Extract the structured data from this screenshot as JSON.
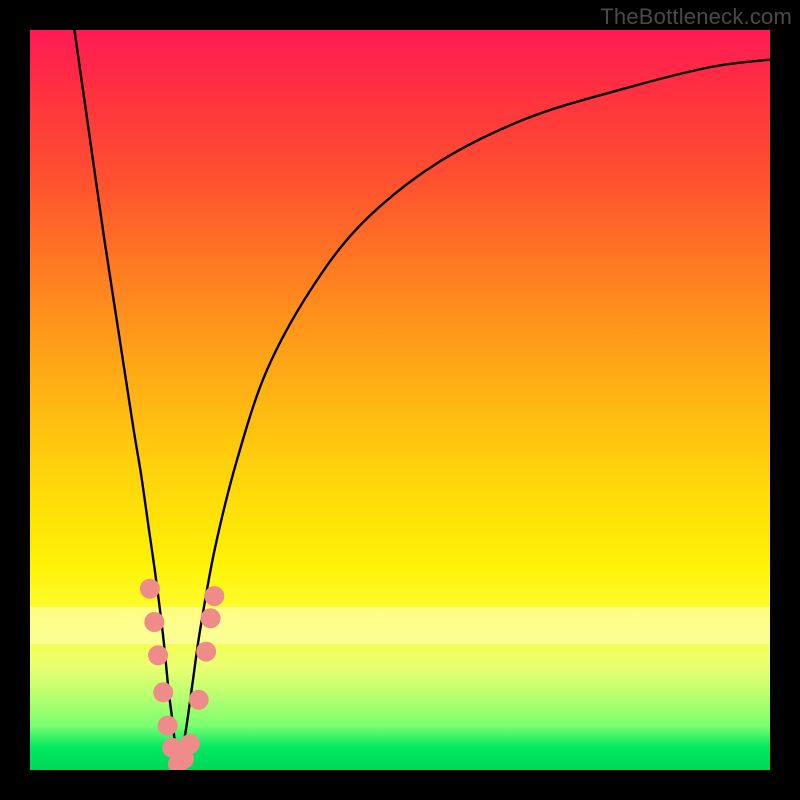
{
  "watermark": "TheBottleneck.com",
  "colors": {
    "frame": "#000000",
    "curve": "#000000",
    "marker_fill": "#ef8b88",
    "marker_stroke": "#d06b68"
  },
  "chart_data": {
    "type": "line",
    "title": "",
    "xlabel": "",
    "ylabel": "",
    "xlim": [
      0,
      100
    ],
    "ylim": [
      0,
      100
    ],
    "grid": false,
    "series": [
      {
        "name": "left-branch",
        "x": [
          6,
          8,
          10,
          12,
          14,
          15,
          16,
          17,
          18,
          18.7,
          19.2,
          19.6,
          20
        ],
        "y": [
          100,
          86,
          72,
          59,
          46,
          40,
          33,
          26,
          18,
          11,
          7,
          3.5,
          0
        ]
      },
      {
        "name": "right-branch",
        "x": [
          20,
          21,
          22,
          23,
          25,
          28,
          32,
          38,
          45,
          55,
          67,
          80,
          92,
          100
        ],
        "y": [
          0,
          5,
          12,
          19,
          30,
          42,
          54,
          65,
          74,
          82,
          88,
          92,
          95,
          96
        ]
      }
    ],
    "markers": [
      {
        "x": 16.2,
        "y": 24.5
      },
      {
        "x": 16.8,
        "y": 20.0
      },
      {
        "x": 17.3,
        "y": 15.5
      },
      {
        "x": 18.0,
        "y": 10.5
      },
      {
        "x": 18.6,
        "y": 6.0
      },
      {
        "x": 19.2,
        "y": 3.0
      },
      {
        "x": 20.0,
        "y": 0.8
      },
      {
        "x": 20.8,
        "y": 1.5
      },
      {
        "x": 21.6,
        "y": 3.5
      },
      {
        "x": 22.8,
        "y": 9.5
      },
      {
        "x": 23.8,
        "y": 16.0
      },
      {
        "x": 24.4,
        "y": 20.5
      },
      {
        "x": 24.9,
        "y": 23.5
      }
    ]
  }
}
